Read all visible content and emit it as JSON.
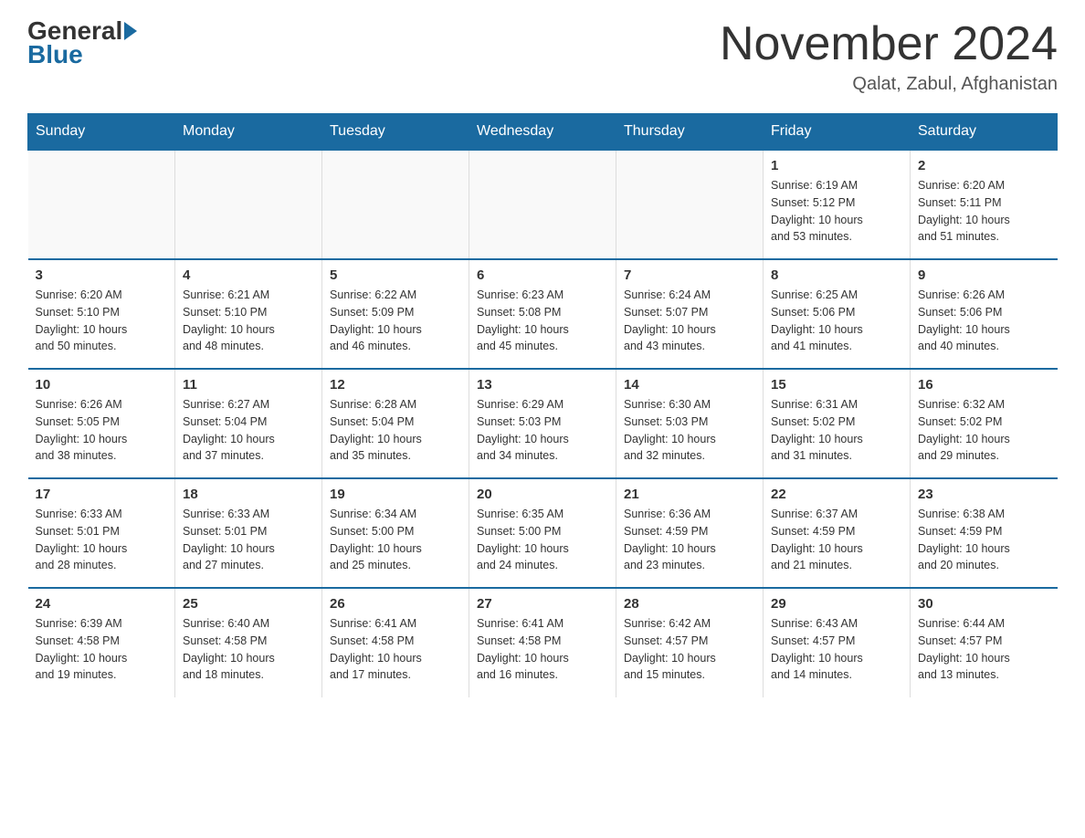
{
  "logo": {
    "general": "General",
    "blue": "Blue"
  },
  "header": {
    "month_title": "November 2024",
    "location": "Qalat, Zabul, Afghanistan"
  },
  "days_of_week": [
    "Sunday",
    "Monday",
    "Tuesday",
    "Wednesday",
    "Thursday",
    "Friday",
    "Saturday"
  ],
  "weeks": [
    [
      {
        "day": "",
        "info": ""
      },
      {
        "day": "",
        "info": ""
      },
      {
        "day": "",
        "info": ""
      },
      {
        "day": "",
        "info": ""
      },
      {
        "day": "",
        "info": ""
      },
      {
        "day": "1",
        "info": "Sunrise: 6:19 AM\nSunset: 5:12 PM\nDaylight: 10 hours\nand 53 minutes."
      },
      {
        "day": "2",
        "info": "Sunrise: 6:20 AM\nSunset: 5:11 PM\nDaylight: 10 hours\nand 51 minutes."
      }
    ],
    [
      {
        "day": "3",
        "info": "Sunrise: 6:20 AM\nSunset: 5:10 PM\nDaylight: 10 hours\nand 50 minutes."
      },
      {
        "day": "4",
        "info": "Sunrise: 6:21 AM\nSunset: 5:10 PM\nDaylight: 10 hours\nand 48 minutes."
      },
      {
        "day": "5",
        "info": "Sunrise: 6:22 AM\nSunset: 5:09 PM\nDaylight: 10 hours\nand 46 minutes."
      },
      {
        "day": "6",
        "info": "Sunrise: 6:23 AM\nSunset: 5:08 PM\nDaylight: 10 hours\nand 45 minutes."
      },
      {
        "day": "7",
        "info": "Sunrise: 6:24 AM\nSunset: 5:07 PM\nDaylight: 10 hours\nand 43 minutes."
      },
      {
        "day": "8",
        "info": "Sunrise: 6:25 AM\nSunset: 5:06 PM\nDaylight: 10 hours\nand 41 minutes."
      },
      {
        "day": "9",
        "info": "Sunrise: 6:26 AM\nSunset: 5:06 PM\nDaylight: 10 hours\nand 40 minutes."
      }
    ],
    [
      {
        "day": "10",
        "info": "Sunrise: 6:26 AM\nSunset: 5:05 PM\nDaylight: 10 hours\nand 38 minutes."
      },
      {
        "day": "11",
        "info": "Sunrise: 6:27 AM\nSunset: 5:04 PM\nDaylight: 10 hours\nand 37 minutes."
      },
      {
        "day": "12",
        "info": "Sunrise: 6:28 AM\nSunset: 5:04 PM\nDaylight: 10 hours\nand 35 minutes."
      },
      {
        "day": "13",
        "info": "Sunrise: 6:29 AM\nSunset: 5:03 PM\nDaylight: 10 hours\nand 34 minutes."
      },
      {
        "day": "14",
        "info": "Sunrise: 6:30 AM\nSunset: 5:03 PM\nDaylight: 10 hours\nand 32 minutes."
      },
      {
        "day": "15",
        "info": "Sunrise: 6:31 AM\nSunset: 5:02 PM\nDaylight: 10 hours\nand 31 minutes."
      },
      {
        "day": "16",
        "info": "Sunrise: 6:32 AM\nSunset: 5:02 PM\nDaylight: 10 hours\nand 29 minutes."
      }
    ],
    [
      {
        "day": "17",
        "info": "Sunrise: 6:33 AM\nSunset: 5:01 PM\nDaylight: 10 hours\nand 28 minutes."
      },
      {
        "day": "18",
        "info": "Sunrise: 6:33 AM\nSunset: 5:01 PM\nDaylight: 10 hours\nand 27 minutes."
      },
      {
        "day": "19",
        "info": "Sunrise: 6:34 AM\nSunset: 5:00 PM\nDaylight: 10 hours\nand 25 minutes."
      },
      {
        "day": "20",
        "info": "Sunrise: 6:35 AM\nSunset: 5:00 PM\nDaylight: 10 hours\nand 24 minutes."
      },
      {
        "day": "21",
        "info": "Sunrise: 6:36 AM\nSunset: 4:59 PM\nDaylight: 10 hours\nand 23 minutes."
      },
      {
        "day": "22",
        "info": "Sunrise: 6:37 AM\nSunset: 4:59 PM\nDaylight: 10 hours\nand 21 minutes."
      },
      {
        "day": "23",
        "info": "Sunrise: 6:38 AM\nSunset: 4:59 PM\nDaylight: 10 hours\nand 20 minutes."
      }
    ],
    [
      {
        "day": "24",
        "info": "Sunrise: 6:39 AM\nSunset: 4:58 PM\nDaylight: 10 hours\nand 19 minutes."
      },
      {
        "day": "25",
        "info": "Sunrise: 6:40 AM\nSunset: 4:58 PM\nDaylight: 10 hours\nand 18 minutes."
      },
      {
        "day": "26",
        "info": "Sunrise: 6:41 AM\nSunset: 4:58 PM\nDaylight: 10 hours\nand 17 minutes."
      },
      {
        "day": "27",
        "info": "Sunrise: 6:41 AM\nSunset: 4:58 PM\nDaylight: 10 hours\nand 16 minutes."
      },
      {
        "day": "28",
        "info": "Sunrise: 6:42 AM\nSunset: 4:57 PM\nDaylight: 10 hours\nand 15 minutes."
      },
      {
        "day": "29",
        "info": "Sunrise: 6:43 AM\nSunset: 4:57 PM\nDaylight: 10 hours\nand 14 minutes."
      },
      {
        "day": "30",
        "info": "Sunrise: 6:44 AM\nSunset: 4:57 PM\nDaylight: 10 hours\nand 13 minutes."
      }
    ]
  ]
}
